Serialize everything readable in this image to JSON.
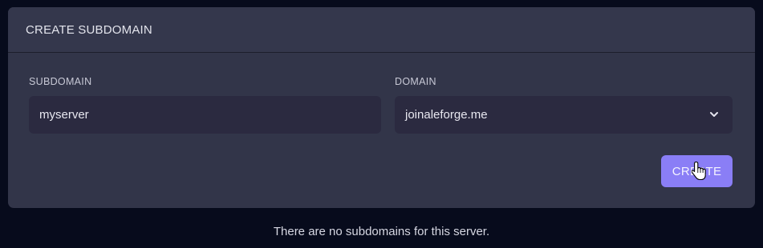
{
  "panel": {
    "title": "CREATE SUBDOMAIN"
  },
  "form": {
    "subdomain": {
      "label": "SUBDOMAIN",
      "value": "myserver"
    },
    "domain": {
      "label": "DOMAIN",
      "selected": "joinaleforge.me",
      "icon": "chevron-down-icon"
    },
    "submit_label": "CREATE"
  },
  "empty_state": "There are no subdomains for this server.",
  "colors": {
    "page_bg": "#070b1c",
    "card_bg": "#323549",
    "input_bg": "#2b2a40",
    "accent": "#8a7ef6"
  }
}
